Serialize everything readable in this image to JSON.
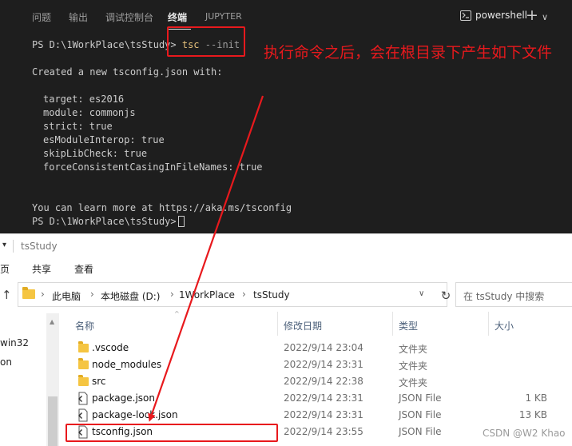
{
  "terminal": {
    "tabs": [
      "问题",
      "输出",
      "调试控制台",
      "终端",
      "JUPYTER"
    ],
    "active_tab": "终端",
    "shell_label": "powershell",
    "prompt": "PS D:\\1WorkPlace\\tsStudy> ",
    "command_name": "tsc",
    "command_args": "--init",
    "created_message": "Created a new tsconfig.json with:",
    "config_lines": [
      "target: es2016",
      "module: commonjs",
      "strict: true",
      "esModuleInterop: true",
      "skipLibCheck: true",
      "forceConsistentCasingInFileNames: true"
    ],
    "learn_more": "You can learn more at https://aka.ms/tsconfig",
    "final_prompt": "PS D:\\1WorkPlace\\tsStudy>"
  },
  "annotation": {
    "note": "执行命令之后，会在根目录下产生如下文件",
    "accent_color": "#e8191d"
  },
  "explorer": {
    "window_title": "tsStudy",
    "ribbon_tabs": [
      "页",
      "共享",
      "查看"
    ],
    "breadcrumb": [
      "此电脑",
      "本地磁盘 (D:)",
      "1WorkPlace",
      "tsStudy"
    ],
    "search_placeholder": "在 tsStudy 中搜索",
    "nav_items": [
      "win32",
      "on"
    ],
    "columns": {
      "name": "名称",
      "date": "修改日期",
      "type": "类型",
      "size": "大小"
    },
    "files": [
      {
        "name": ".vscode",
        "date": "2022/9/14 23:04",
        "type": "文件夹",
        "size": "",
        "icon": "folder-icon"
      },
      {
        "name": "node_modules",
        "date": "2022/9/14 23:31",
        "type": "文件夹",
        "size": "",
        "icon": "folder-icon"
      },
      {
        "name": "src",
        "date": "2022/9/14 22:38",
        "type": "文件夹",
        "size": "",
        "icon": "folder-icon"
      },
      {
        "name": "package.json",
        "date": "2022/9/14 23:31",
        "type": "JSON File",
        "size": "1 KB",
        "icon": "json-file-icon"
      },
      {
        "name": "package-lock.json",
        "date": "2022/9/14 23:31",
        "type": "JSON File",
        "size": "13 KB",
        "icon": "json-file-icon"
      },
      {
        "name": "tsconfig.json",
        "date": "2022/9/14 23:55",
        "type": "JSON File",
        "size": "",
        "icon": "json-file-icon"
      }
    ]
  },
  "watermark": "CSDN @W2 Khao"
}
